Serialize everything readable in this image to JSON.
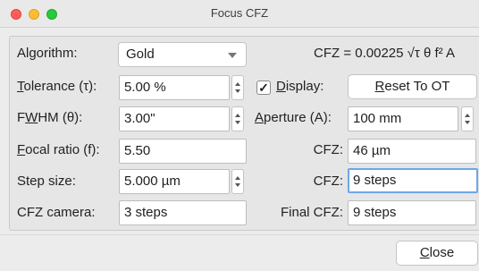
{
  "window": {
    "title": "Focus CFZ"
  },
  "formula": "CFZ = 0.00225 √τ θ f² A",
  "algorithm": {
    "label": "Algorithm:",
    "value": "Gold"
  },
  "tolerance": {
    "label_prefix": "",
    "label_u": "T",
    "label_rest": "olerance (τ):",
    "value": "5.00 %"
  },
  "display": {
    "checked": true,
    "check_glyph": "✓",
    "label_u": "D",
    "label_rest": "isplay:"
  },
  "reset_button": {
    "label_u": "R",
    "label_rest": "eset To OT"
  },
  "fwhm": {
    "label_pre": "F",
    "label_u": "W",
    "label_rest": "HM (θ):",
    "value": "3.00\""
  },
  "aperture": {
    "label_u": "A",
    "label_rest": "perture (A):",
    "value": "100 mm"
  },
  "focal_ratio": {
    "label_u": "F",
    "label_rest": "ocal ratio (f):",
    "value": "5.50"
  },
  "cfz_um": {
    "label": "CFZ:",
    "value": "46 µm"
  },
  "step_size": {
    "label": "Step size:",
    "value": "5.000 µm"
  },
  "cfz_steps": {
    "label": "CFZ:",
    "value": "9 steps"
  },
  "cfz_camera": {
    "label": "CFZ camera:",
    "value": "3 steps"
  },
  "final_cfz": {
    "label": "Final CFZ:",
    "value": "9 steps"
  },
  "close_button": {
    "label_u": "C",
    "label_rest": "lose"
  }
}
